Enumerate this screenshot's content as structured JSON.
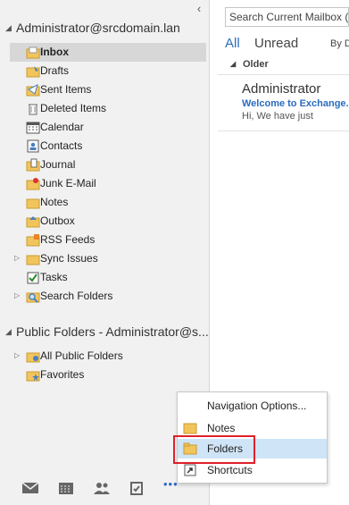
{
  "nav": {
    "collapse_glyph": "‹",
    "account": {
      "expand_glyph": "◢",
      "name": "Administrator@srcdomain.lan"
    },
    "folders": [
      {
        "label": "Inbox",
        "icon": "inbox-icon",
        "selected": true
      },
      {
        "label": "Drafts",
        "icon": "drafts-icon"
      },
      {
        "label": "Sent Items",
        "icon": "sent-items-icon"
      },
      {
        "label": "Deleted Items",
        "icon": "deleted-items-icon"
      },
      {
        "label": "Calendar",
        "icon": "calendar-icon"
      },
      {
        "label": "Contacts",
        "icon": "contacts-icon"
      },
      {
        "label": "Journal",
        "icon": "journal-icon"
      },
      {
        "label": "Junk E-Mail",
        "icon": "junk-email-icon"
      },
      {
        "label": "Notes",
        "icon": "notes-icon"
      },
      {
        "label": "Outbox",
        "icon": "outbox-icon"
      },
      {
        "label": "RSS Feeds",
        "icon": "rss-feeds-icon"
      },
      {
        "label": "Sync Issues",
        "icon": "sync-issues-icon",
        "expandable": true
      },
      {
        "label": "Tasks",
        "icon": "tasks-icon"
      },
      {
        "label": "Search Folders",
        "icon": "search-folders-icon",
        "expandable": true
      }
    ],
    "public_account": {
      "expand_glyph": "◢",
      "name": "Public Folders - Administrator@s..."
    },
    "public_folders": [
      {
        "label": "All Public Folders",
        "icon": "public-folder-icon",
        "expandable": true
      },
      {
        "label": "Favorites",
        "icon": "favorites-icon"
      }
    ],
    "expand_glyph": "▷"
  },
  "bottom_bar": {
    "items": [
      "mail-icon",
      "calendar-icon",
      "people-icon",
      "tasks-icon",
      "more-options-icon"
    ],
    "more_label": "•••"
  },
  "reading": {
    "search_placeholder": "Search Current Mailbox (Ctrl",
    "filter_all": "All",
    "filter_unread": "Unread",
    "filter_by": "By D",
    "group_glyph": "◢",
    "group_name": "Older",
    "mail": {
      "from": "Administrator",
      "subject": "Welcome to Exchange..",
      "preview": "Hi,  We have just"
    }
  },
  "popup": {
    "items": [
      {
        "label": "Navigation Options...",
        "icon": "",
        "accel": "v"
      },
      {
        "label": "Notes",
        "icon": "notes-icon"
      },
      {
        "label": "Folders",
        "icon": "folders-icon",
        "highlighted": true
      },
      {
        "label": "Shortcuts",
        "icon": "shortcuts-icon"
      }
    ]
  },
  "colors": {
    "accent": "#2b6cbf",
    "folder_yellow": "#f2c55c",
    "highlight_red": "#e0202a",
    "selected_bg": "#d7d7d7",
    "menu_highlight": "#cfe4f7"
  }
}
